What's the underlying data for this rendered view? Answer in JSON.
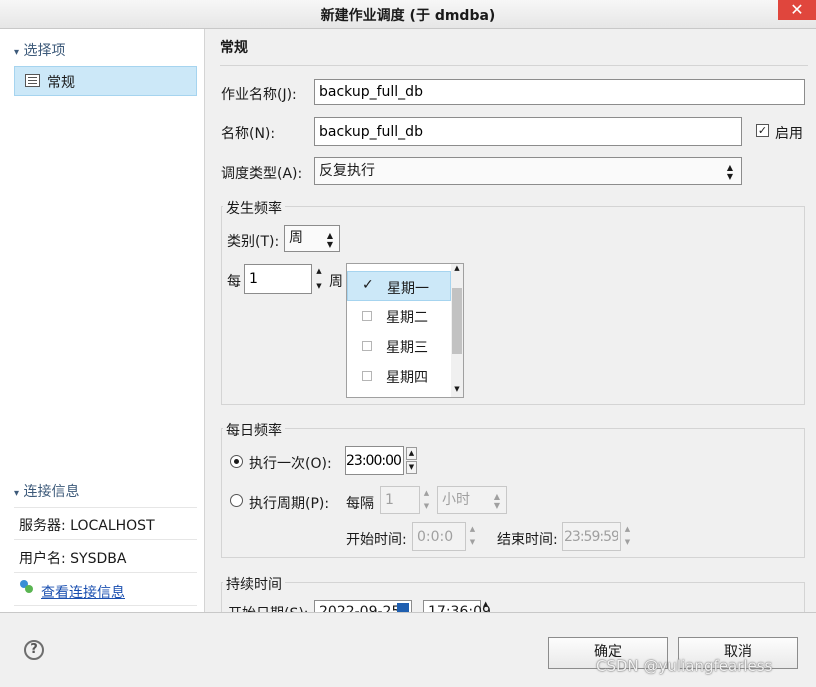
{
  "window": {
    "title": "新建作业调度 (于 dmdba)",
    "close": "✕"
  },
  "sidebar": {
    "select_header": "选择项",
    "items": [
      {
        "label": "常规"
      }
    ],
    "conn_header": "连接信息",
    "server": "服务器: LOCALHOST",
    "user": "用户名: SYSDBA",
    "view_link": "查看连接信息"
  },
  "main": {
    "section_title": "常规",
    "job_name_label": "作业名称(J):",
    "job_name_value": "backup_full_db",
    "name_label": "名称(N):",
    "name_value": "backup_full_db",
    "enabled_label": "启用",
    "schedule_type_label": "调度类型(A):",
    "schedule_type_value": "反复执行"
  },
  "frequency": {
    "group_label": "发生频率",
    "category_label": "类别(T):",
    "category_value": "周",
    "every_label": "每",
    "every_value": "1",
    "unit_label": "周",
    "days": [
      {
        "label": "星期一",
        "checked": true
      },
      {
        "label": "星期二",
        "checked": false
      },
      {
        "label": "星期三",
        "checked": false
      },
      {
        "label": "星期四",
        "checked": false
      }
    ]
  },
  "daily": {
    "group_label": "每日频率",
    "once_label": "执行一次(O):",
    "once_time": "23:00:00",
    "periodic_label": "执行周期(P):",
    "interval_label": "每隔",
    "interval_value": "1",
    "interval_unit": "小时",
    "start_label": "开始时间:",
    "start_value": "0:0:0",
    "end_label": "结束时间:",
    "end_value": "23:59:59"
  },
  "duration": {
    "group_label": "持续时间",
    "start_date_label": "开始日期(S):",
    "start_date_value": "2022-09-25",
    "start_time_value": "17:36:09"
  },
  "footer": {
    "ok": "确定",
    "cancel": "取消",
    "watermark": "CSDN @yuliangfearless"
  }
}
